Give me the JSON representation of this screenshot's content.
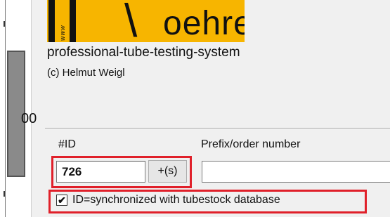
{
  "logo": {
    "vertical_text": "www",
    "slash": "\\",
    "word": "oehren",
    "colors": {
      "background": "#f7b500",
      "ink": "#111111"
    }
  },
  "subtitle": "professional-tube-testing-system",
  "copyright": "(c) Helmut Weigl",
  "left_fragment": "00",
  "form": {
    "id_label": "#ID",
    "id_value": "726",
    "plus_button_label": "+(s)",
    "prefix_label": "Prefix/order number",
    "prefix_value": "",
    "sync_checkbox": {
      "checked": true,
      "check_glyph": "✔",
      "label": "ID=synchronized with tubestock database"
    }
  },
  "highlight_color": "#e0202a"
}
